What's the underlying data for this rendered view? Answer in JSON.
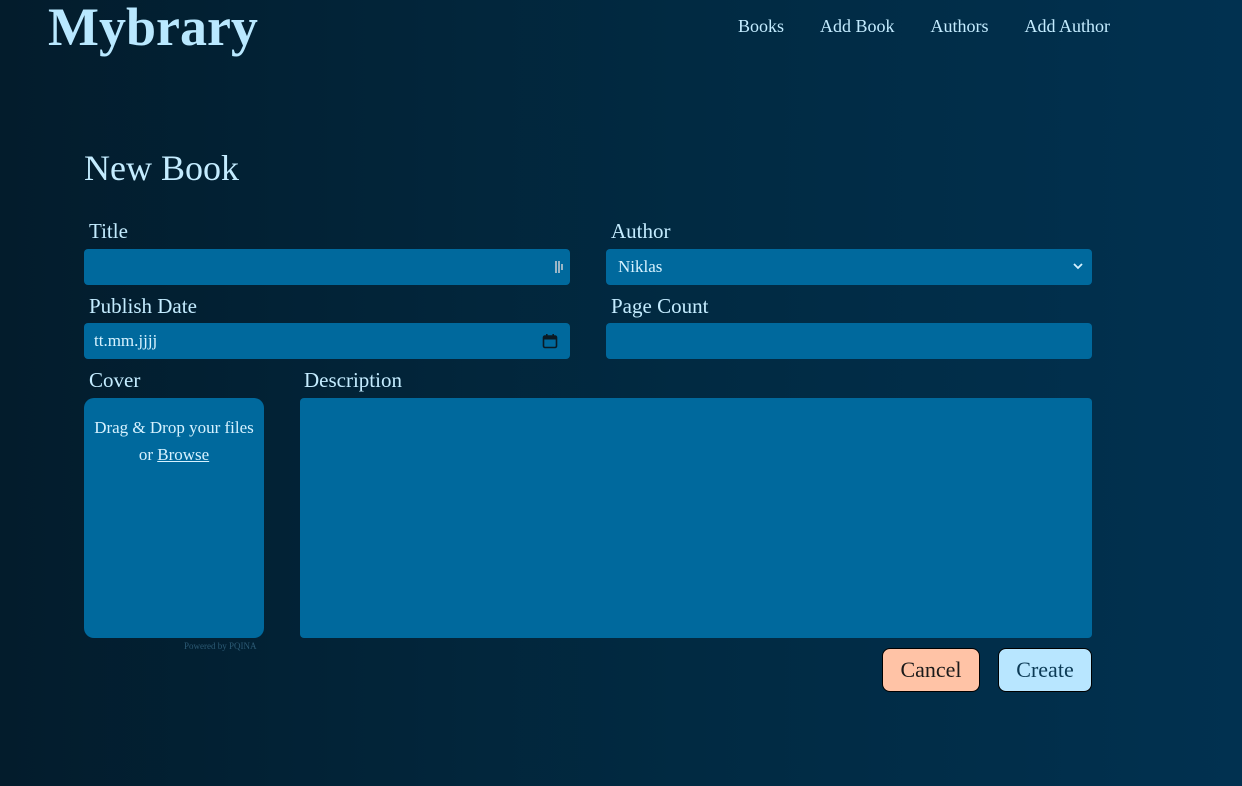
{
  "app": {
    "logo": "Mybrary",
    "nav": [
      "Books",
      "Add Book",
      "Authors",
      "Add Author"
    ]
  },
  "form": {
    "title": "New Book",
    "title_label": "Title",
    "title_value": "",
    "author_label": "Author",
    "author_selected": "Niklas",
    "publish_date_label": "Publish Date",
    "publish_date_placeholder": "tt.mm.jjjj",
    "page_count_label": "Page Count",
    "page_count_value": "",
    "cover_label": "Cover",
    "cover_drop_text": "Drag & Drop your files or",
    "cover_browse": "Browse",
    "cover_powered": "Powered by PQINA",
    "description_label": "Description",
    "description_value": "",
    "cancel_label": "Cancel",
    "create_label": "Create"
  },
  "colors": {
    "background": "#022740",
    "field": "#00699d",
    "text": "#c4ecff",
    "cancel": "#ffc3a6",
    "create": "#b8e6ff"
  }
}
